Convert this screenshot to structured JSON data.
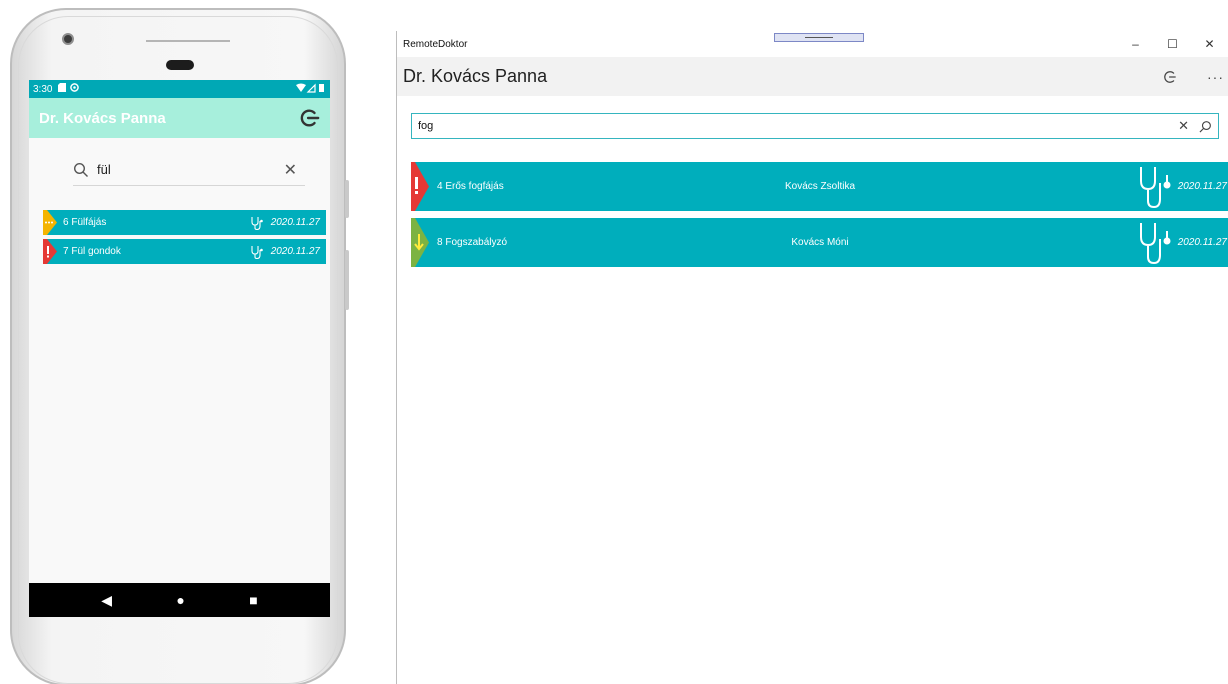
{
  "mobile": {
    "status": {
      "time": "3:30",
      "left_icons": "sd-card-icon, sync-icon",
      "right_icons": "wifi, signal, battery"
    },
    "app_title": "Dr. Kovács Panna",
    "search": {
      "value": "fül"
    },
    "items": [
      {
        "label": "6 Fülfájás",
        "date": "2020.11.27",
        "priority": "medium",
        "badge_color": "#f4b400",
        "badge_glyph": "..."
      },
      {
        "label": "7 Fül gondok",
        "date": "2020.11.27",
        "priority": "high",
        "badge_color": "#e53935",
        "badge_glyph": "!"
      }
    ],
    "nav": {
      "back": "◀",
      "home": "●",
      "recent": "■"
    }
  },
  "desktop": {
    "window_title": "RemoteDoktor",
    "window_controls": {
      "minimize": "–",
      "maximize": "☐",
      "close": "✕"
    },
    "page_title": "Dr. Kovács Panna",
    "more": "···",
    "search": {
      "value": "fog"
    },
    "items": [
      {
        "label": "4 Erős fogfájás",
        "patient": "Kovács Zsoltika",
        "date": "2020.11.27",
        "priority": "high",
        "badge_color": "#e53935",
        "badge_glyph": "!"
      },
      {
        "label": "8 Fogszabályzó",
        "patient": "Kovács Móni",
        "date": "2020.11.27",
        "priority": "low",
        "badge_color": "#7cb342",
        "badge_glyph": "↓"
      }
    ]
  },
  "colors": {
    "accent": "#00aebc",
    "mobile_appbar": "#a7efdc",
    "status_bar": "#00a8b5"
  }
}
